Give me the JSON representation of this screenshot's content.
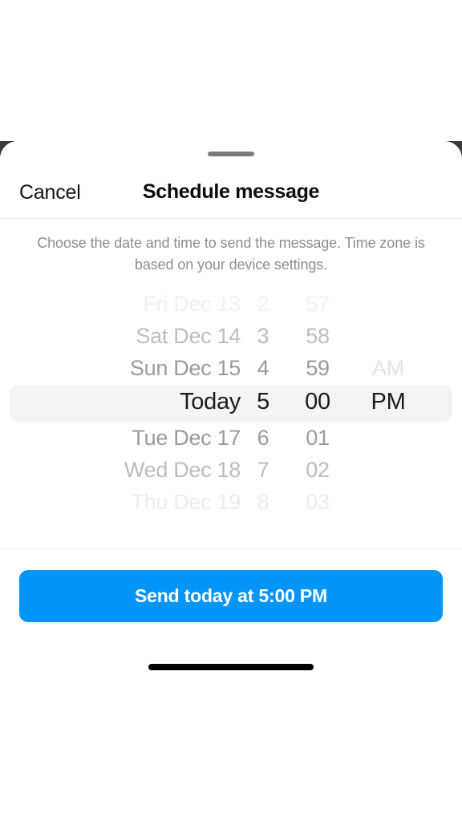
{
  "sheet": {
    "grabber": "drag-handle",
    "cancel_label": "Cancel",
    "title": "Schedule message",
    "subtitle": "Choose the date and time to send the message. Time zone is based on your device settings."
  },
  "picker": {
    "selected": {
      "date": "Today",
      "hour": "5",
      "minute": "00",
      "ampm": "PM"
    },
    "rows": [
      {
        "date": "Fri Dec 13",
        "hour": "2",
        "minute": "57",
        "ampm": ""
      },
      {
        "date": "Sat Dec 14",
        "hour": "3",
        "minute": "58",
        "ampm": ""
      },
      {
        "date": "Sun Dec 15",
        "hour": "4",
        "minute": "59",
        "ampm": "AM"
      },
      {
        "date": "Today",
        "hour": "5",
        "minute": "00",
        "ampm": "PM"
      },
      {
        "date": "Tue Dec 17",
        "hour": "6",
        "minute": "01",
        "ampm": ""
      },
      {
        "date": "Wed Dec 18",
        "hour": "7",
        "minute": "02",
        "ampm": ""
      },
      {
        "date": "Thu Dec 19",
        "hour": "8",
        "minute": "03",
        "ampm": ""
      }
    ]
  },
  "footer": {
    "send_label": "Send today at 5:00 PM"
  },
  "colors": {
    "accent": "#0495fa",
    "selection_band": "#f4f4f6",
    "title": "#0b0b0b",
    "subtitle": "#8e8e93",
    "home_indicator": "#000000"
  }
}
